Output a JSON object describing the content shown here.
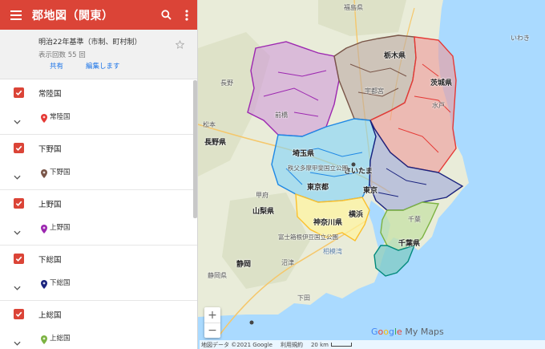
{
  "header": {
    "title": "郡地図（関東）",
    "menu_icon": "menu-icon",
    "search_icon": "search-icon",
    "more_icon": "more-vert-icon",
    "color": "#db4437"
  },
  "map_info": {
    "name": "明治22年基準（市制、町村制）",
    "views": "表示回数 55 回",
    "share_label": "共有",
    "edit_label": "編集します"
  },
  "layers": [
    {
      "name": "常陸国",
      "sublabel": "常陸国",
      "pin_color": "#e53935"
    },
    {
      "name": "下野国",
      "sublabel": "下野国",
      "pin_color": "#795548"
    },
    {
      "name": "上野国",
      "sublabel": "上野国",
      "pin_color": "#9c27b0"
    },
    {
      "name": "下総国",
      "sublabel": "下総国",
      "pin_color": "#1a237e"
    },
    {
      "name": "上総国",
      "sublabel": "上総国",
      "pin_color": "#7cb342"
    }
  ],
  "map_labels": {
    "fukushima": "福島県",
    "iwaki": "いわき",
    "nagano": "長野",
    "matsumoto": "松本",
    "naganoken": "長野県",
    "tochigi": "栃木県",
    "maebashi": "前橋",
    "utsunomiya": "宇都宮",
    "ibaraki": "茨城県",
    "mito": "水戸",
    "saitama_ken": "埼玉県",
    "saitama": "さいたま",
    "tokyo_to": "東京都",
    "tokyo": "東京",
    "yamanashi": "山梨県",
    "kofu": "甲府",
    "kanagawa": "神奈川県",
    "yokohama": "横浜",
    "chiba_ken": "千葉県",
    "chiba": "千葉",
    "shizuoka": "静岡",
    "shizuoka_ken": "静岡県",
    "numazu": "沼津",
    "chichibu": "秩父多摩甲斐国立公園",
    "fuji": "富士箱根伊豆国立公園",
    "sagami": "相模湾",
    "shimoda": "下田"
  },
  "brand": {
    "google": "Google",
    "mymaps": "My Maps"
  },
  "footer": {
    "data": "地図データ ©2021 Google",
    "terms": "利用規約",
    "scale": "20 km"
  },
  "zoom": {
    "in": "+",
    "out": "−"
  },
  "colors": {
    "hitachi": "#e53935",
    "shimotsuke": "#795548",
    "kozuke": "#9c27b0",
    "shimousa": "#1a237e",
    "kazusa": "#7cb342",
    "musashi": "#1e88e5",
    "sagami": "#fbc02d",
    "awa": "#00897b",
    "sea": "#aadaff"
  }
}
